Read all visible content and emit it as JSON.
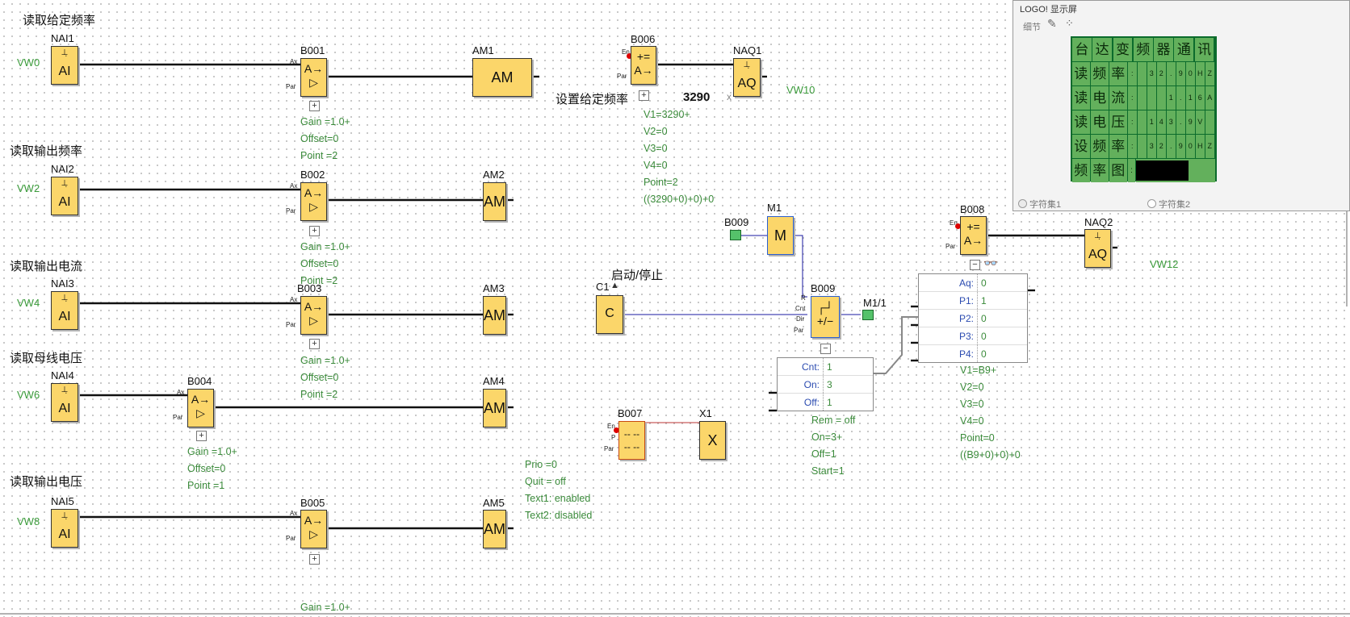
{
  "colors": {
    "block": "#fbd66a",
    "param": "#3a8a3a",
    "wire": "#111111",
    "lcd_bg": "#0b6b2c",
    "lcd_cell": "#63b05c",
    "flag": "#55c26a"
  },
  "titles": {
    "t1": "读取给定频率",
    "t2": "读取输出频率",
    "t3": "读取输出电流",
    "t4": "读取母线电压",
    "t5": "读取输出电压",
    "set_freq": "设置给定频率",
    "set_freq_value": "3290",
    "start_stop": "启动/停止"
  },
  "vw": {
    "vw0": "VW0",
    "vw2": "VW2",
    "vw4": "VW4",
    "vw6": "VW6",
    "vw8": "VW8",
    "vw10": "VW10",
    "vw12": "VW12"
  },
  "names": {
    "nai1": "NAI1",
    "nai2": "NAI2",
    "nai3": "NAI3",
    "nai4": "NAI4",
    "nai5": "NAI5",
    "b001": "B001",
    "b002": "B002",
    "b003": "B003",
    "b004": "B004",
    "b005": "B005",
    "b006": "B006",
    "b007": "B007",
    "b008": "B008",
    "b009": "B009",
    "am1": "AM1",
    "am2": "AM2",
    "am3": "AM3",
    "am4": "AM4",
    "am5": "AM5",
    "naq1": "NAQ1",
    "naq2": "NAQ2",
    "m1": "M1",
    "c1": "C1",
    "x1": "X1",
    "b009_flag": "B009",
    "m1_1": "M1/1"
  },
  "symbols": {
    "ai": "AI",
    "aq": "AQ",
    "am": "AM",
    "amp": "A→\n▷",
    "math": "+=\nA→",
    "m": "M",
    "c": "C",
    "x": "X",
    "cnt": "┌┘\n+/−",
    "msg": "-- --\n-- --"
  },
  "pins": {
    "ax": "Ax",
    "par": "Par",
    "en": "En",
    "r": "R",
    "cnt": "Cnt",
    "dir": "Dir",
    "p": "P"
  },
  "params": {
    "b001": "Gain =1.0+\nOffset=0\nPoint =2",
    "b002": "Gain =1.0+\nOffset=0\nPoint =2",
    "b003": "Gain =1.0+\nOffset=0\nPoint =2",
    "b004": "Gain =1.0+\nOffset=0\nPoint =1",
    "b005": "Gain =1.0+",
    "b006": "V1=3290+\nV2=0\nV3=0\nV4=0\nPoint=2\n((3290+0)+0)+0",
    "b007": "Prio =0\nQuit = off\nText1: enabled\nText2: disabled",
    "b009": "Rem = off\nOn=3+\nOff=1\nStart=1",
    "b008": "V1=B9+\nV2=0\nV3=0\nV4=0\nPoint=0\n((B9+0)+0)+0"
  },
  "table_b009": [
    {
      "k": "Cnt:",
      "v": "1"
    },
    {
      "k": "On:",
      "v": "3"
    },
    {
      "k": "Off:",
      "v": "1"
    }
  ],
  "table_b008": [
    {
      "k": "Aq:",
      "v": "0"
    },
    {
      "k": "P1:",
      "v": "1"
    },
    {
      "k": "P2:",
      "v": "0"
    },
    {
      "k": "P3:",
      "v": "0"
    },
    {
      "k": "P4:",
      "v": "0"
    }
  ],
  "panel": {
    "title": "LOGO! 显示屏",
    "detail": "细节",
    "charset1": "字符集1",
    "charset2": "字符集2",
    "rows": [
      {
        "label": [
          "台",
          "达",
          "变",
          "频",
          "器",
          "通",
          "讯"
        ],
        "vals": []
      },
      {
        "label": [
          "读",
          "频",
          "率"
        ],
        "vals": [
          ":",
          "",
          "3",
          "2",
          ".",
          "9",
          "0",
          "H",
          "Z"
        ]
      },
      {
        "label": [
          "读",
          "电",
          "流"
        ],
        "vals": [
          ":",
          "",
          "",
          "",
          "1",
          ".",
          "1",
          "6",
          "A"
        ]
      },
      {
        "label": [
          "读",
          "电",
          "压"
        ],
        "vals": [
          ":",
          "",
          "1",
          "4",
          "3",
          ".",
          "9",
          "V",
          ""
        ]
      },
      {
        "label": [
          "设",
          "频",
          "率"
        ],
        "vals": [
          ":",
          "",
          "3",
          "2",
          ".",
          "9",
          "0",
          "H",
          "Z"
        ]
      },
      {
        "label": [
          "频",
          "率",
          "图"
        ],
        "vals": [
          ":"
        ]
      }
    ],
    "bar_fraction": 0.66
  }
}
